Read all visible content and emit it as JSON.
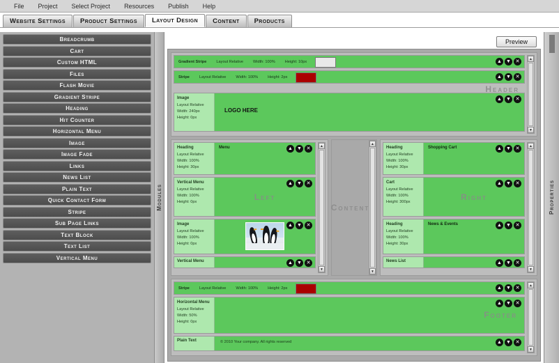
{
  "menubar": {
    "items": [
      {
        "label": "File"
      },
      {
        "label": "Project"
      },
      {
        "label": "Select Project"
      },
      {
        "label": "Resources"
      },
      {
        "label": "Publish"
      },
      {
        "label": "Help"
      }
    ]
  },
  "tabs": [
    {
      "label": "Website Settings",
      "active": false
    },
    {
      "label": "Product Settings",
      "active": false
    },
    {
      "label": "Layout Design",
      "active": true
    },
    {
      "label": "Content",
      "active": false
    },
    {
      "label": "Products",
      "active": false
    }
  ],
  "modules_pane": {
    "vertical_label": "Modules",
    "items": [
      {
        "label": "Breadcrumb"
      },
      {
        "label": "Cart"
      },
      {
        "label": "Custom HTML"
      },
      {
        "label": "Files"
      },
      {
        "label": "Flash Movie"
      },
      {
        "label": "Gradient Stripe"
      },
      {
        "label": "Heading"
      },
      {
        "label": "Hit Counter"
      },
      {
        "label": "Horizontal Menu"
      },
      {
        "label": "Image"
      },
      {
        "label": "Image Fade"
      },
      {
        "label": "Links"
      },
      {
        "label": "News List"
      },
      {
        "label": "Plain Text"
      },
      {
        "label": "Quick Contact Form"
      },
      {
        "label": "Stripe"
      },
      {
        "label": "Sub Page Links"
      },
      {
        "label": "Text Block"
      },
      {
        "label": "Text List"
      },
      {
        "label": "Vertical Menu"
      }
    ]
  },
  "toolbar": {
    "preview_label": "Preview"
  },
  "properties_pane": {
    "vertical_label": "Properties"
  },
  "icons": {
    "move_up": "▲",
    "move_down": "▼",
    "remove": "✕"
  },
  "colors": {
    "block_green": "#5cc85c",
    "info_green": "#aee8ae",
    "panel_gray": "#bdbdbd",
    "canvas_gray": "#a9a9a9",
    "stripe_red": "#aa0000",
    "gradient_swatch": "#e9e9e9"
  },
  "canvas": {
    "header": {
      "watermark": "Header",
      "blocks": [
        {
          "name": "Gradient Stripe",
          "layout": "Layout Relative",
          "width": "Width: 100%",
          "height": "Height: 10px",
          "inline": true,
          "swatch": "#e9e9e9"
        },
        {
          "name": "Stripe",
          "layout": "Layout Relative",
          "width": "Width: 100%",
          "height": "Height: 2px",
          "inline": true,
          "swatch": "#aa0000"
        },
        {
          "name": "Image",
          "layout": "Layout Relative",
          "width": "Width: 240px",
          "height": "Height: 0px",
          "title": "LOGO HERE"
        }
      ]
    },
    "left_column": {
      "watermark": "Left",
      "blocks": [
        {
          "name": "Heading",
          "layout": "Layout Relative",
          "width": "Width: 100%",
          "height": "Height: 30px",
          "title": "Menu"
        },
        {
          "name": "Vertical Menu",
          "layout": "Layout Relative",
          "width": "Width: 100%",
          "height": "Height: 0px",
          "title": ""
        },
        {
          "name": "Image",
          "layout": "Layout Relative",
          "width": "Width: 100%",
          "height": "Height: 0px",
          "title": "",
          "has_photo": true
        },
        {
          "name": "Vertical Menu",
          "collapsed": true
        }
      ]
    },
    "content_column": {
      "watermark": "Content"
    },
    "right_column": {
      "watermark": "Right",
      "blocks": [
        {
          "name": "Heading",
          "layout": "Layout Relative",
          "width": "Width: 100%",
          "height": "Height: 30px",
          "title": "Shopping Cart"
        },
        {
          "name": "Cart",
          "layout": "Layout Relative",
          "width": "Width: 100%",
          "height": "Height: 300px",
          "title": ""
        },
        {
          "name": "Heading",
          "layout": "Layout Relative",
          "width": "Width: 100%",
          "height": "Height: 30px",
          "title": "News & Events"
        },
        {
          "name": "News List",
          "collapsed": true
        }
      ]
    },
    "footer": {
      "watermark": "Footer",
      "blocks": [
        {
          "name": "Stripe",
          "layout": "Layout Relative",
          "width": "Width: 100%",
          "height": "Height: 2px",
          "inline": true,
          "swatch": "#aa0000"
        },
        {
          "name": "Horizontal Menu",
          "layout": "Layout Relative",
          "width": "Width: 50%",
          "height": "Height: 0px",
          "title": ""
        },
        {
          "name": "Plain Text",
          "layout": "Layout Relative",
          "width": "",
          "height": "",
          "title": "© 2010 Your company. All rights reserved"
        }
      ]
    }
  }
}
